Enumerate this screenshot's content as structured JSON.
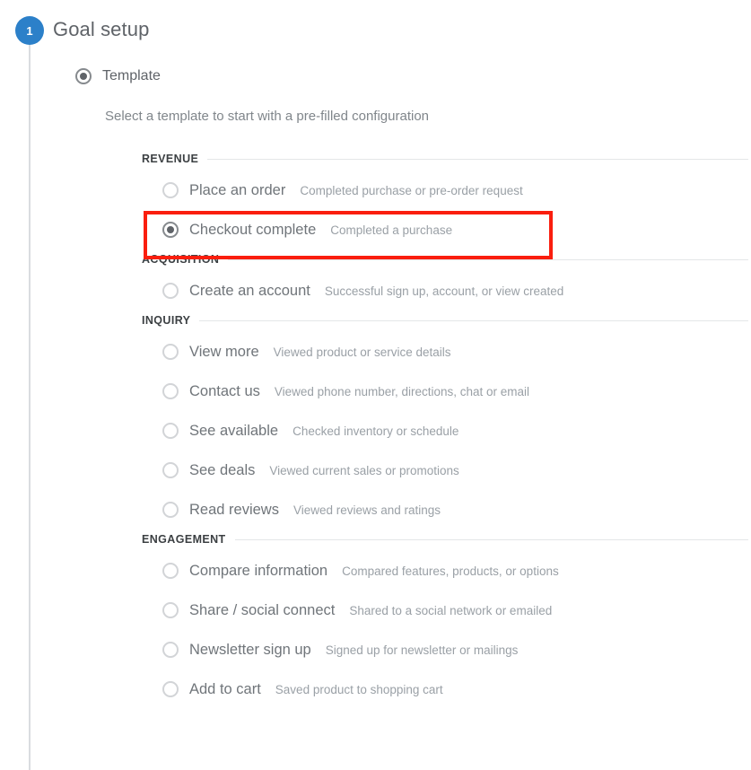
{
  "step": {
    "number": "1",
    "title": "Goal setup",
    "badge_color": "#2c80c9"
  },
  "template_option": {
    "label": "Template",
    "selected": true
  },
  "subtitle": "Select a template to start with a pre-filled configuration",
  "highlight": {
    "color": "#fa1e0e",
    "target": "Checkout complete"
  },
  "groups": [
    {
      "title": "REVENUE",
      "options": [
        {
          "name": "Place an order",
          "desc": "Completed purchase or pre-order request",
          "selected": false,
          "highlighted": false
        },
        {
          "name": "Checkout complete",
          "desc": "Completed a purchase",
          "selected": true,
          "highlighted": true
        }
      ]
    },
    {
      "title": "ACQUISITION",
      "options": [
        {
          "name": "Create an account",
          "desc": "Successful sign up, account, or view created",
          "selected": false,
          "highlighted": false
        }
      ]
    },
    {
      "title": "INQUIRY",
      "options": [
        {
          "name": "View more",
          "desc": "Viewed product or service details",
          "selected": false,
          "highlighted": false
        },
        {
          "name": "Contact us",
          "desc": "Viewed phone number, directions, chat or email",
          "selected": false,
          "highlighted": false
        },
        {
          "name": "See available",
          "desc": "Checked inventory or schedule",
          "selected": false,
          "highlighted": false
        },
        {
          "name": "See deals",
          "desc": "Viewed current sales or promotions",
          "selected": false,
          "highlighted": false
        },
        {
          "name": "Read reviews",
          "desc": "Viewed reviews and ratings",
          "selected": false,
          "highlighted": false
        }
      ]
    },
    {
      "title": "ENGAGEMENT",
      "options": [
        {
          "name": "Compare information",
          "desc": "Compared features, products, or options",
          "selected": false,
          "highlighted": false
        },
        {
          "name": "Share / social connect",
          "desc": "Shared to a social network or emailed",
          "selected": false,
          "highlighted": false
        },
        {
          "name": "Newsletter sign up",
          "desc": "Signed up for newsletter or mailings",
          "selected": false,
          "highlighted": false
        },
        {
          "name": "Add to cart",
          "desc": "Saved product to shopping cart",
          "selected": false,
          "highlighted": false
        }
      ]
    }
  ]
}
